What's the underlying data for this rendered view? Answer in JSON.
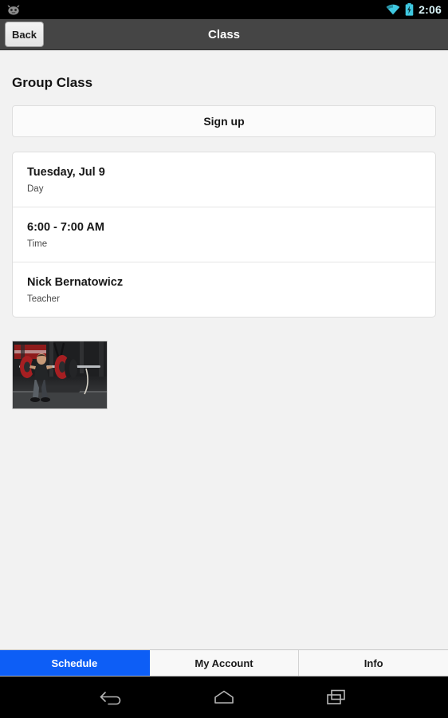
{
  "status_bar": {
    "notification_icon": "android-app-icon",
    "wifi_icon": "wifi-icon",
    "battery_icon": "battery-charging-icon",
    "time": "2:06",
    "accent_color": "#3fc8e0"
  },
  "action_bar": {
    "back_label": "Back",
    "title": "Class",
    "background_color": "#454545"
  },
  "main": {
    "page_title": "Group Class",
    "signup_label": "Sign up",
    "details": [
      {
        "value": "Tuesday, Jul 9",
        "label": "Day"
      },
      {
        "value": "6:00 - 7:00 AM",
        "label": "Time"
      },
      {
        "value": "Nick Bernatowicz",
        "label": "Teacher"
      }
    ],
    "photo": {
      "name": "class-photo",
      "alt": "Athlete performing a front squat with a loaded barbell in a gym"
    }
  },
  "tab_bar": {
    "active_color": "#0d5ef6",
    "tabs": [
      {
        "label": "Schedule",
        "active": true
      },
      {
        "label": "My Account",
        "active": false
      },
      {
        "label": "Info",
        "active": false
      }
    ]
  },
  "nav_bar": {
    "buttons": [
      {
        "icon": "back-nav-icon"
      },
      {
        "icon": "home-nav-icon"
      },
      {
        "icon": "recents-nav-icon"
      }
    ]
  }
}
